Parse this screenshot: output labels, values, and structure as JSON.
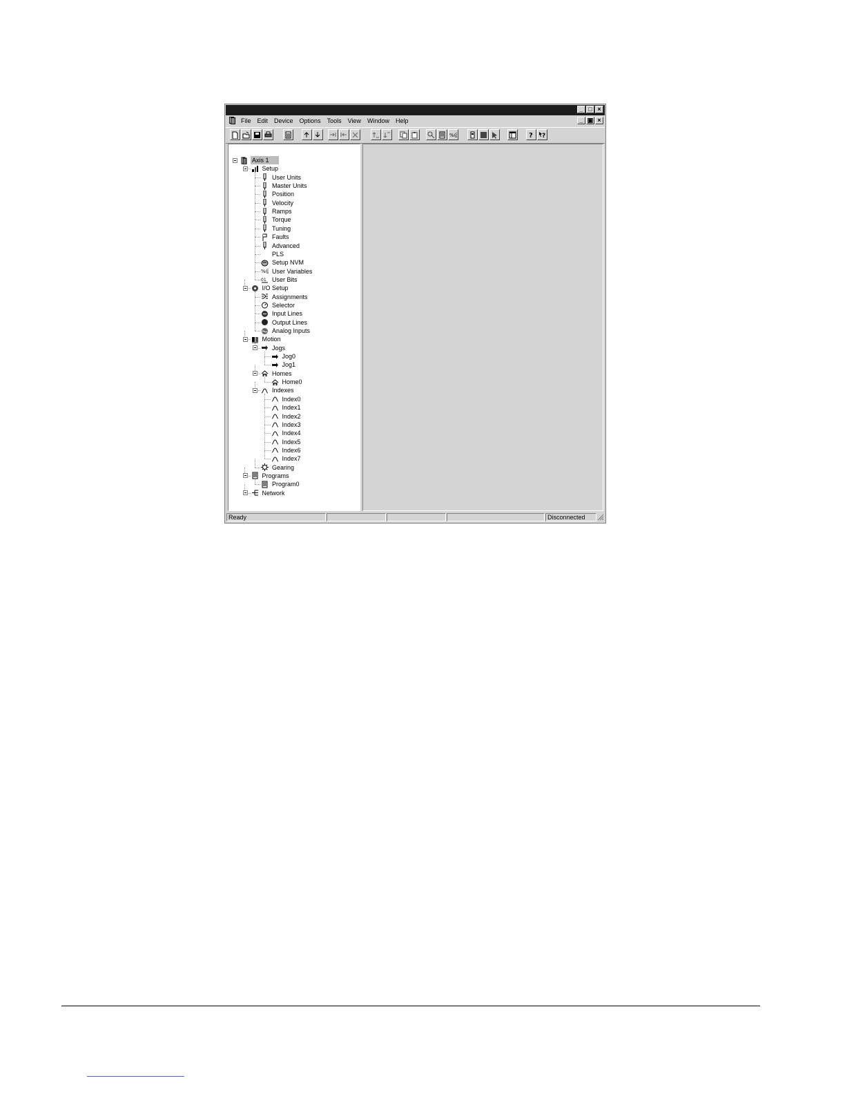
{
  "menu": {
    "items": [
      {
        "id": "file",
        "label": "File"
      },
      {
        "id": "edit",
        "label": "Edit"
      },
      {
        "id": "device",
        "label": "Device"
      },
      {
        "id": "options",
        "label": "Options"
      },
      {
        "id": "tools",
        "label": "Tools"
      },
      {
        "id": "view",
        "label": "View"
      },
      {
        "id": "window",
        "label": "Window"
      },
      {
        "id": "help",
        "label": "Help"
      }
    ]
  },
  "toolbar": {
    "buttons": [
      {
        "id": "new",
        "icon": "new-document-icon"
      },
      {
        "id": "open",
        "icon": "open-folder-icon"
      },
      {
        "id": "save",
        "icon": "save-disk-icon"
      },
      {
        "id": "print",
        "icon": "printer-icon"
      },
      {
        "id": "properties",
        "icon": "properties-icon"
      },
      {
        "id": "upload",
        "icon": "upload-icon"
      },
      {
        "id": "download",
        "icon": "download-icon"
      },
      {
        "id": "connect",
        "icon": "connect-icon"
      },
      {
        "id": "disconnect",
        "icon": "disconnect-icon"
      },
      {
        "id": "stop",
        "icon": "stop-x-icon"
      },
      {
        "id": "sort-up",
        "icon": "sort-ascending-icon"
      },
      {
        "id": "sort-down",
        "icon": "sort-descending-icon"
      },
      {
        "id": "copy",
        "icon": "copy-icon"
      },
      {
        "id": "paste",
        "icon": "paste-icon"
      },
      {
        "id": "find",
        "icon": "find-icon"
      },
      {
        "id": "program",
        "icon": "program-icon"
      },
      {
        "id": "variables",
        "icon": "variables-icon"
      },
      {
        "id": "drive",
        "icon": "drive-icon"
      },
      {
        "id": "halt",
        "icon": "halt-square-icon"
      },
      {
        "id": "pointer",
        "icon": "pointer-icon"
      },
      {
        "id": "layout",
        "icon": "layout-window-icon"
      },
      {
        "id": "help",
        "icon": "help-icon"
      },
      {
        "id": "context-help",
        "icon": "context-help-icon"
      }
    ]
  },
  "tree": {
    "nodes": [
      {
        "id": "axis1",
        "label": "Axis 1",
        "depth": 0,
        "icon": "axis-device-icon",
        "expander": true,
        "selected": true
      },
      {
        "id": "setup",
        "label": "Setup",
        "depth": 1,
        "icon": "setup-icon",
        "expander": true
      },
      {
        "id": "user-units",
        "label": "User Units",
        "depth": 2,
        "icon": "parameter-icon"
      },
      {
        "id": "master-units",
        "label": "Master Units",
        "depth": 2,
        "icon": "parameter-icon"
      },
      {
        "id": "position",
        "label": "Position",
        "depth": 2,
        "icon": "parameter-icon"
      },
      {
        "id": "velocity",
        "label": "Velocity",
        "depth": 2,
        "icon": "parameter-icon"
      },
      {
        "id": "ramps",
        "label": "Ramps",
        "depth": 2,
        "icon": "parameter-icon"
      },
      {
        "id": "torque",
        "label": "Torque",
        "depth": 2,
        "icon": "parameter-icon"
      },
      {
        "id": "tuning",
        "label": "Tuning",
        "depth": 2,
        "icon": "parameter-icon"
      },
      {
        "id": "faults",
        "label": "Faults",
        "depth": 2,
        "icon": "flag-icon"
      },
      {
        "id": "advanced",
        "label": "Advanced",
        "depth": 2,
        "icon": "parameter-icon"
      },
      {
        "id": "pls",
        "label": "PLS",
        "depth": 2,
        "icon": "none"
      },
      {
        "id": "setup-nvm",
        "label": "Setup NVM",
        "depth": 2,
        "icon": "nvm-icon"
      },
      {
        "id": "user-variables",
        "label": "User Variables",
        "depth": 2,
        "icon": "variables-icon"
      },
      {
        "id": "user-bits",
        "label": "User Bits",
        "depth": 2,
        "icon": "bits-icon"
      },
      {
        "id": "io-setup",
        "label": "I/O Setup",
        "depth": 1,
        "icon": "io-icon",
        "expander": true
      },
      {
        "id": "assignments",
        "label": "Assignments",
        "depth": 2,
        "icon": "assignments-icon"
      },
      {
        "id": "selector",
        "label": "Selector",
        "depth": 2,
        "icon": "selector-icon"
      },
      {
        "id": "input-lines",
        "label": "Input Lines",
        "depth": 2,
        "icon": "input-lines-icon"
      },
      {
        "id": "output-lines",
        "label": "Output Lines",
        "depth": 2,
        "icon": "output-lines-icon"
      },
      {
        "id": "analog-inputs",
        "label": "Analog Inputs",
        "depth": 2,
        "icon": "analog-icon"
      },
      {
        "id": "motion",
        "label": "Motion",
        "depth": 1,
        "icon": "motion-icon",
        "expander": true
      },
      {
        "id": "jogs",
        "label": "Jogs",
        "depth": 2,
        "icon": "jogs-icon",
        "expander": true
      },
      {
        "id": "jog0",
        "label": "Jog0",
        "depth": 3,
        "icon": "arrow-right-icon"
      },
      {
        "id": "jog1",
        "label": "Jog1",
        "depth": 3,
        "icon": "arrow-right-icon"
      },
      {
        "id": "homes",
        "label": "Homes",
        "depth": 2,
        "icon": "home-icon",
        "expander": true
      },
      {
        "id": "home0",
        "label": "Home0",
        "depth": 3,
        "icon": "home-icon"
      },
      {
        "id": "indexes",
        "label": "Indexes",
        "depth": 2,
        "icon": "profile-curve-icon",
        "expander": true
      },
      {
        "id": "index0",
        "label": "Index0",
        "depth": 3,
        "icon": "profile-curve-icon"
      },
      {
        "id": "index1",
        "label": "Index1",
        "depth": 3,
        "icon": "profile-curve-icon"
      },
      {
        "id": "index2",
        "label": "Index2",
        "depth": 3,
        "icon": "profile-curve-icon"
      },
      {
        "id": "index3",
        "label": "Index3",
        "depth": 3,
        "icon": "profile-curve-icon"
      },
      {
        "id": "index4",
        "label": "Index4",
        "depth": 3,
        "icon": "profile-curve-icon"
      },
      {
        "id": "index5",
        "label": "Index5",
        "depth": 3,
        "icon": "profile-curve-icon"
      },
      {
        "id": "index6",
        "label": "Index6",
        "depth": 3,
        "icon": "profile-curve-icon"
      },
      {
        "id": "index7",
        "label": "Index7",
        "depth": 3,
        "icon": "profile-curve-icon"
      },
      {
        "id": "gearing",
        "label": "Gearing",
        "depth": 2,
        "icon": "gearing-icon"
      },
      {
        "id": "programs",
        "label": "Programs",
        "depth": 1,
        "icon": "programs-icon",
        "expander": true
      },
      {
        "id": "program0",
        "label": "Program0",
        "depth": 2,
        "icon": "program-icon"
      },
      {
        "id": "network",
        "label": "Network",
        "depth": 1,
        "icon": "network-icon",
        "expander": true
      }
    ]
  },
  "status": {
    "message": "Ready",
    "panel2": "",
    "panel3": "",
    "panel4": "",
    "connection": "Disconnected"
  },
  "colors": {
    "title_bar": "#1c1c1c",
    "chrome": "#d4d4d4",
    "tree_background": "#ffffff",
    "selection": "#bdbdbd"
  }
}
